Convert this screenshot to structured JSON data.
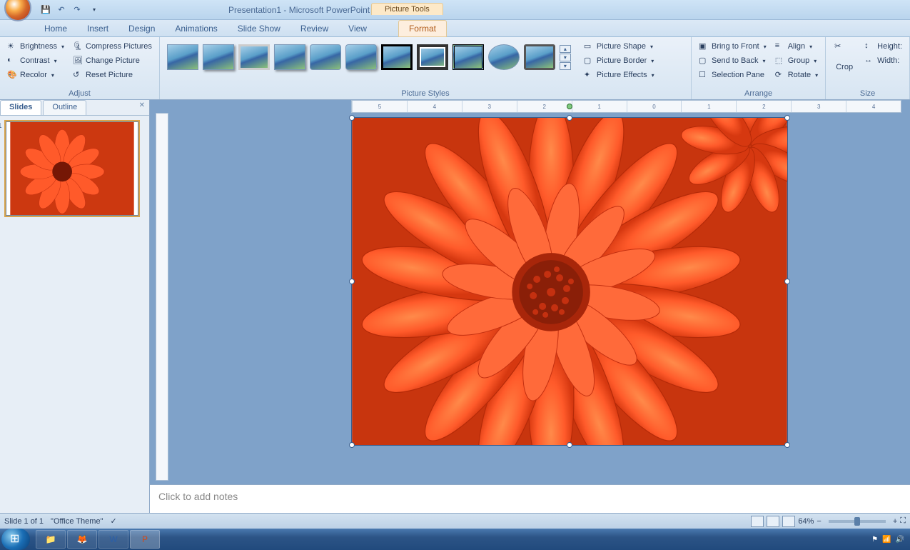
{
  "title": "Presentation1 - Microsoft PowerPoint",
  "picture_tools_label": "Picture Tools",
  "tabs": [
    "Home",
    "Insert",
    "Design",
    "Animations",
    "Slide Show",
    "Review",
    "View"
  ],
  "context_tab": "Format",
  "ribbon": {
    "adjust": {
      "brightness": "Brightness",
      "contrast": "Contrast",
      "recolor": "Recolor",
      "compress": "Compress Pictures",
      "change": "Change Picture",
      "reset": "Reset Picture",
      "label": "Adjust"
    },
    "styles": {
      "picture_shape": "Picture Shape",
      "picture_border": "Picture Border",
      "picture_effects": "Picture Effects",
      "label": "Picture Styles"
    },
    "arrange": {
      "bring_front": "Bring to Front",
      "send_back": "Send to Back",
      "selection_pane": "Selection Pane",
      "align": "Align",
      "group": "Group",
      "rotate": "Rotate",
      "label": "Arrange"
    },
    "size": {
      "crop": "Crop",
      "height": "Height:",
      "width": "Width:",
      "label": "Size"
    }
  },
  "panel": {
    "slides": "Slides",
    "outline": "Outline"
  },
  "notes_placeholder": "Click to add notes",
  "status": {
    "slide": "Slide 1 of 1",
    "theme": "\"Office Theme\"",
    "zoom": "64%"
  },
  "ruler_h": [
    "5",
    "4",
    "3",
    "2",
    "1",
    "0",
    "1",
    "2",
    "3",
    "4"
  ],
  "taskbar_icons": [
    "explorer",
    "firefox",
    "word",
    "powerpoint"
  ]
}
